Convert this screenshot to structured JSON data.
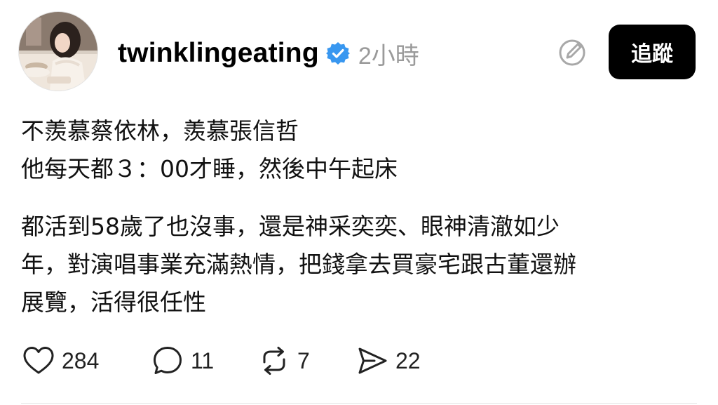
{
  "post": {
    "username": "twinklingeating",
    "timestamp": "2小時",
    "follow_label": "追蹤",
    "paragraphs": [
      [
        "不羨慕蔡依林，羨慕張信哲",
        "他每天都３：00才睡，然後中午起床"
      ],
      [
        "都活到58歲了也沒事，還是神采奕奕、眼神清澈如少",
        "年，對演唱事業充滿熱情，把錢拿去買豪宅跟古董還辦",
        "展覽，活得很任性"
      ]
    ]
  },
  "actions": {
    "likes": "284",
    "replies": "11",
    "reposts": "7",
    "shares": "22"
  },
  "icons": {
    "verified": "verified-badge-icon",
    "edit": "edit-circle-icon",
    "like": "heart-icon",
    "reply": "comment-bubble-icon",
    "repost": "repost-arrows-icon",
    "share": "send-arrow-icon"
  },
  "colors": {
    "verified_blue": "#3897f0",
    "follow_bg": "#000000",
    "timestamp_gray": "#9a9a9a"
  }
}
